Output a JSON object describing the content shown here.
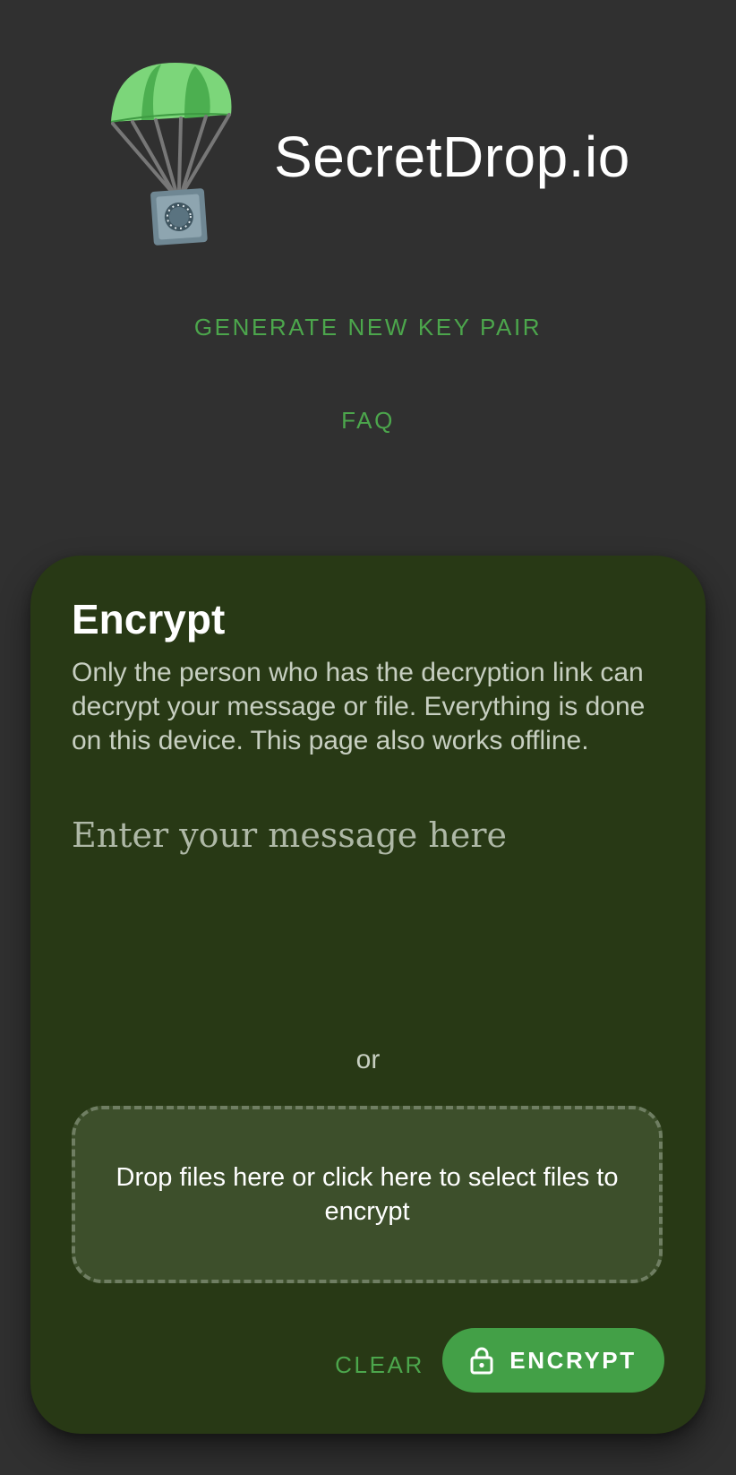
{
  "header": {
    "site_title": "SecretDrop.io",
    "logo_icon": "parachute-safe-logo"
  },
  "nav": {
    "generate_label": "GENERATE NEW KEY PAIR",
    "faq_label": "FAQ"
  },
  "encrypt_card": {
    "title": "Encrypt",
    "description": "Only the person who has the decryption link can decrypt your message or file. Everything is done on this device. This page also works offline.",
    "message_placeholder": "Enter your message here",
    "message_value": "",
    "or_text": "or",
    "dropzone_text": "Drop files here or click here to select files to encrypt",
    "clear_label": "CLEAR",
    "encrypt_label": "ENCRYPT",
    "encrypt_icon": "lock-icon"
  },
  "colors": {
    "page_background": "#303030",
    "card_background": "#283915",
    "accent_green": "#43a047",
    "link_green": "#4ca64c",
    "dropzone_background": "#3d4f2b"
  }
}
